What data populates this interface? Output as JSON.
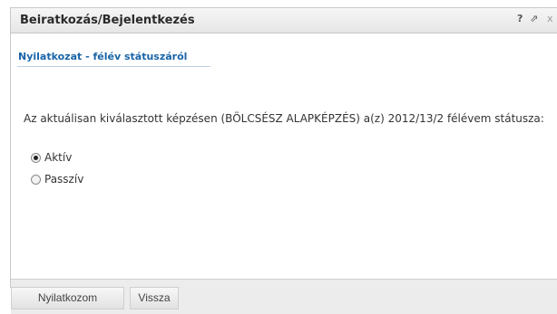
{
  "window": {
    "title": "Beiratkozás/Bejelentkezés",
    "icons": {
      "help": "?",
      "popout": "⇗",
      "close": "x"
    }
  },
  "tab": {
    "label": "Nyilatkozat - félév státuszáról"
  },
  "statement": {
    "text": "Az aktuálisan kiválasztott képzésen (BÖLCSÉSZ ALAPKÉPZÉS) a(z) 2012/13/2 félévem státusza:"
  },
  "options": [
    {
      "label": "Aktív",
      "selected": true
    },
    {
      "label": "Passzív",
      "selected": false
    }
  ],
  "buttons": {
    "submit": "Nyilatkozom",
    "back": "Vissza"
  },
  "colors": {
    "tab_link": "#1a64a8",
    "footer_bg": "#ececec",
    "title_text": "#2b2b2b"
  }
}
